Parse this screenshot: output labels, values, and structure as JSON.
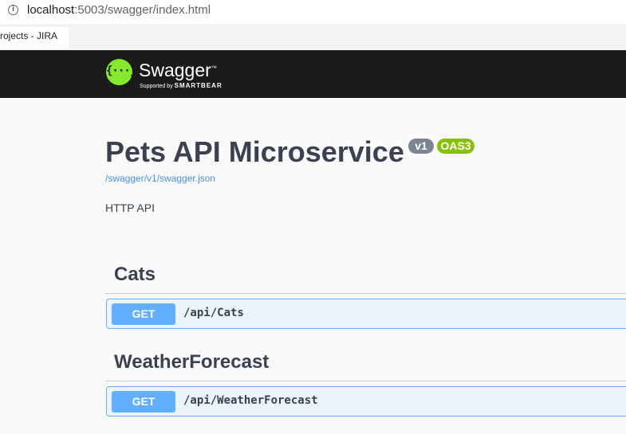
{
  "browser": {
    "url_host": "localhost",
    "url_rest": ":5003/swagger/index.html",
    "bookmark_label": "Projects - JIRA"
  },
  "topbar": {
    "logo_glyph": "{···}",
    "brand": "Swagger",
    "tm": "™",
    "supported_by": "Supported by",
    "smartbear": "SMARTBEAR"
  },
  "info": {
    "title": "Pets API Microservice",
    "version_badge": "v1",
    "oas_badge": "OAS3",
    "spec_link": "/swagger/v1/swagger.json",
    "description": "HTTP API"
  },
  "tags": [
    {
      "name": "Cats",
      "operations": [
        {
          "method": "GET",
          "path": "/api/Cats"
        }
      ]
    },
    {
      "name": "WeatherForecast",
      "operations": [
        {
          "method": "GET",
          "path": "/api/WeatherForecast"
        }
      ]
    }
  ],
  "colors": {
    "topbar": "#1b1b1b",
    "logo_green": "#85ea2d",
    "get_blue": "#61affe",
    "get_bg": "#ebf3fb",
    "oas_green": "#89bf04",
    "version_gray": "#7d8492",
    "text": "#3b4151",
    "link": "#4990e2"
  }
}
